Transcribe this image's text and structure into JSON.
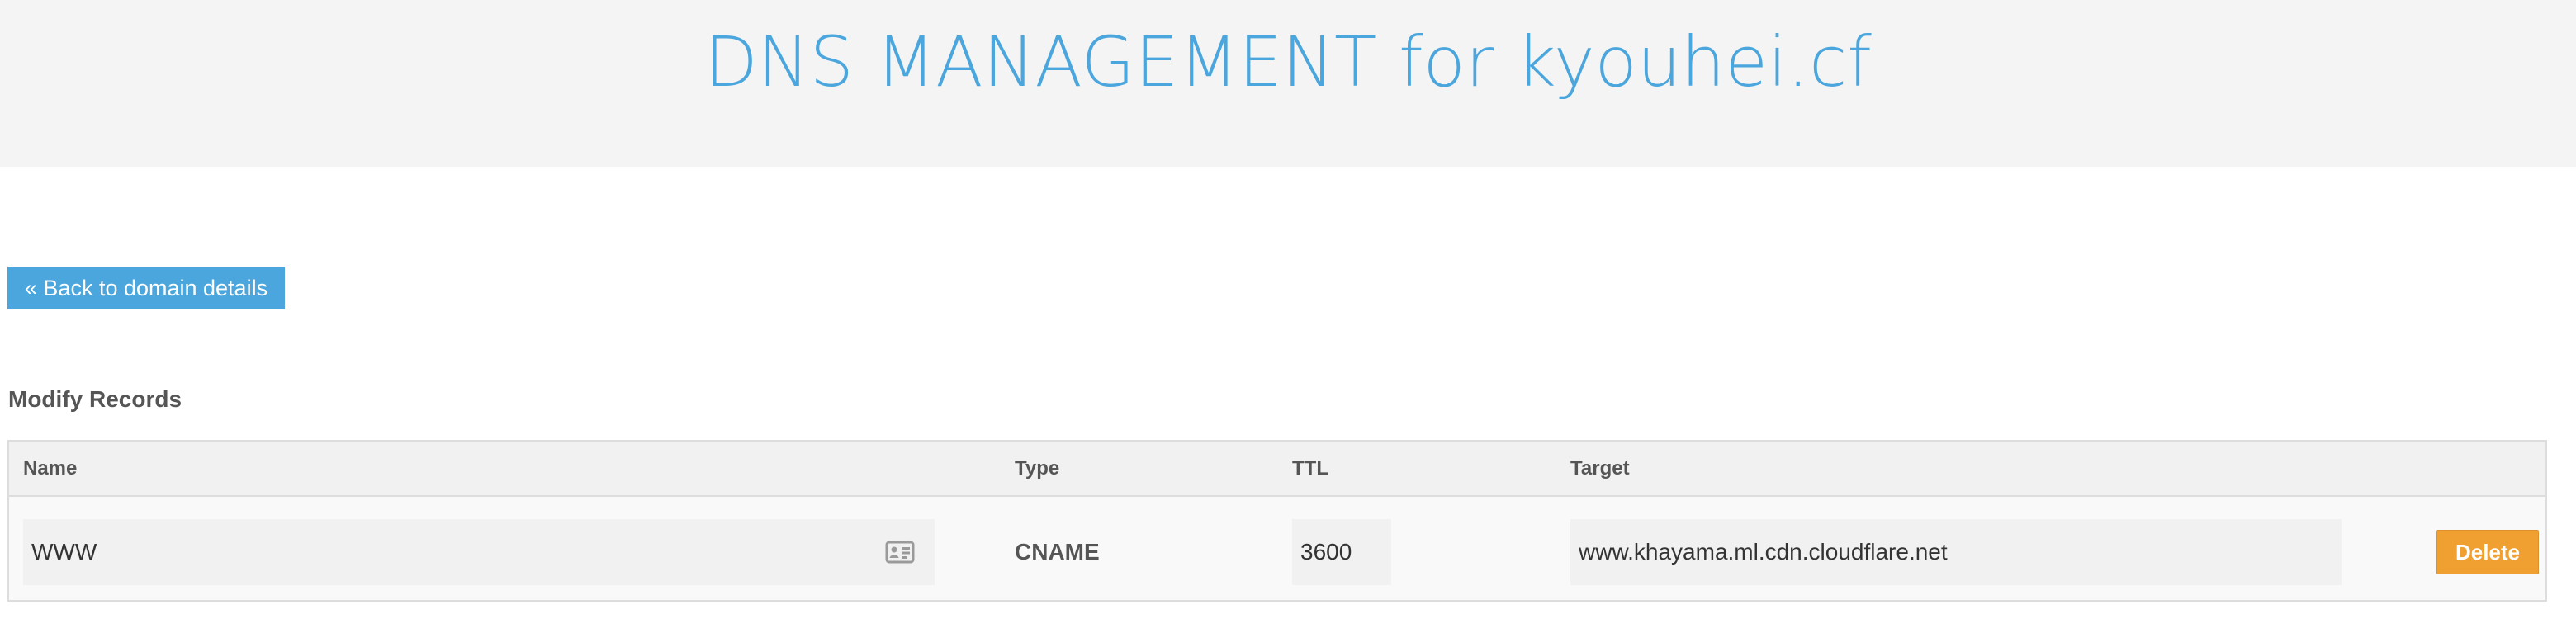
{
  "header": {
    "title": "DNS MANAGEMENT for kyouhei.cf"
  },
  "back_button": {
    "label": "« Back to domain details"
  },
  "section": {
    "title": "Modify Records"
  },
  "table": {
    "columns": {
      "name": "Name",
      "type": "Type",
      "ttl": "TTL",
      "target": "Target"
    },
    "rows": [
      {
        "name": "WWW",
        "type": "CNAME",
        "ttl": "3600",
        "target": "www.khayama.ml.cdn.cloudflare.net",
        "delete_label": "Delete"
      }
    ]
  },
  "icons": {
    "name_field_icon": "contact-card-icon"
  },
  "colors": {
    "accent": "#4aa6dc",
    "header_bg": "#f4f4f4",
    "delete": "#f0a030"
  }
}
